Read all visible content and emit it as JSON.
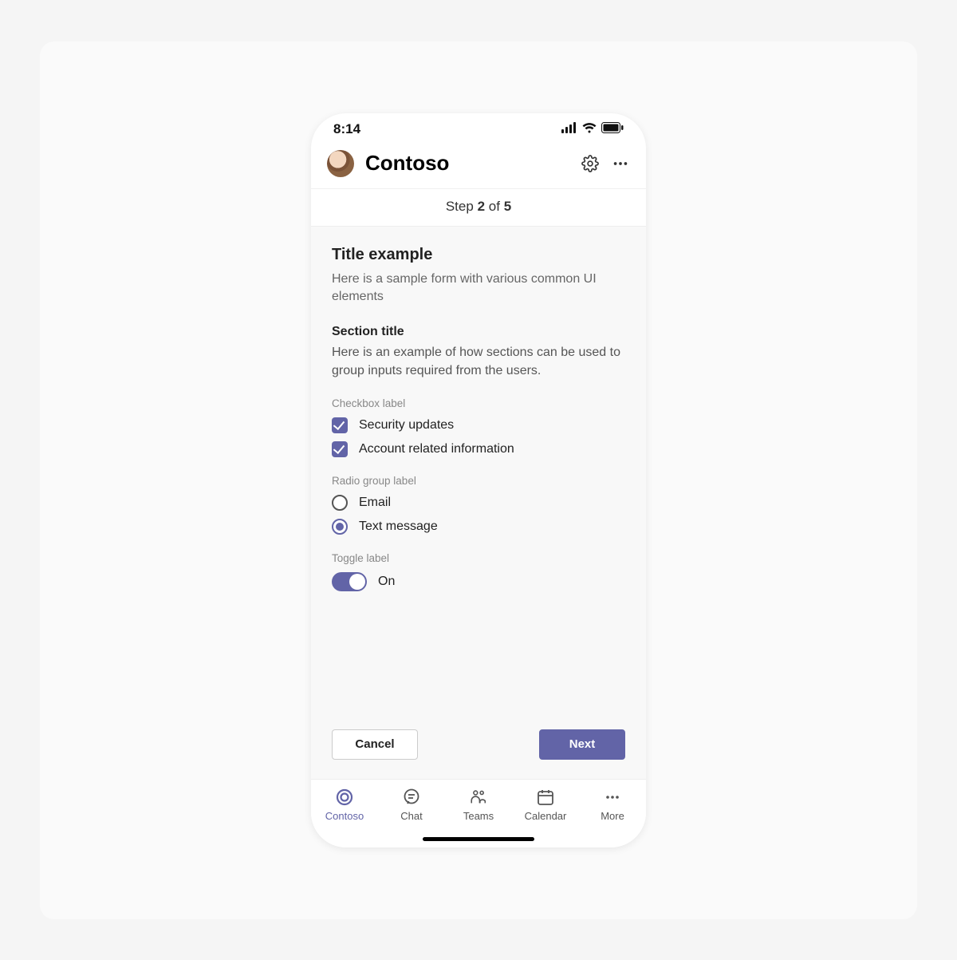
{
  "statusBar": {
    "time": "8:14"
  },
  "header": {
    "title": "Contoso"
  },
  "step": {
    "prefix": "Step",
    "current": "2",
    "of": "of",
    "total": "5"
  },
  "page": {
    "title": "Title example",
    "subtitle": "Here is a sample form with various common UI elements"
  },
  "section": {
    "title": "Section title",
    "desc": "Here is an example of how sections can be used to group inputs required from the users."
  },
  "checkbox": {
    "label": "Checkbox label",
    "items": [
      "Security updates",
      "Account related information"
    ]
  },
  "radio": {
    "label": "Radio group label",
    "items": [
      "Email",
      "Text message"
    ],
    "selectedIndex": 1
  },
  "toggle": {
    "label": "Toggle label",
    "valueLabel": "On"
  },
  "buttons": {
    "cancel": "Cancel",
    "next": "Next"
  },
  "tabs": [
    "Contoso",
    "Chat",
    "Teams",
    "Calendar",
    "More"
  ],
  "colors": {
    "accent": "#6264A7"
  }
}
